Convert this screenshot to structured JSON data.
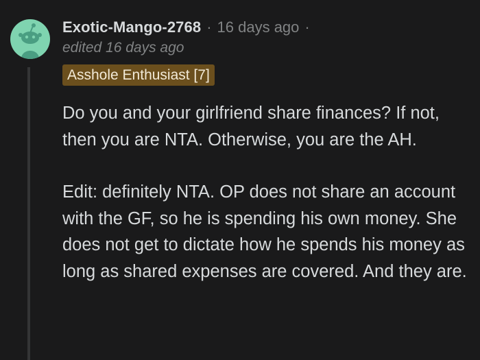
{
  "comment": {
    "author": "Exotic-Mango-2768",
    "separator": "·",
    "timestamp": "16 days ago",
    "trailing_separator": "·",
    "edited_text": "edited 16 days ago",
    "flair": "Asshole Enthusiast [7]",
    "avatar_icon": "snoo-avatar-icon",
    "paragraphs": [
      "Do you and your girlfriend share finances? If not, then you are NTA. Otherwise, you are the AH.",
      "Edit: definitely NTA. OP does not share an account with the GF, so he is spending his own money. She does not get to dictate how he spends his money as long as shared expenses are covered. And they are."
    ]
  },
  "colors": {
    "background": "#1a1a1b",
    "text": "#d7dadc",
    "muted": "#818384",
    "avatar_bg": "#7fd4b0",
    "flair_bg": "#6b4f1d",
    "thread_line": "#343536"
  }
}
